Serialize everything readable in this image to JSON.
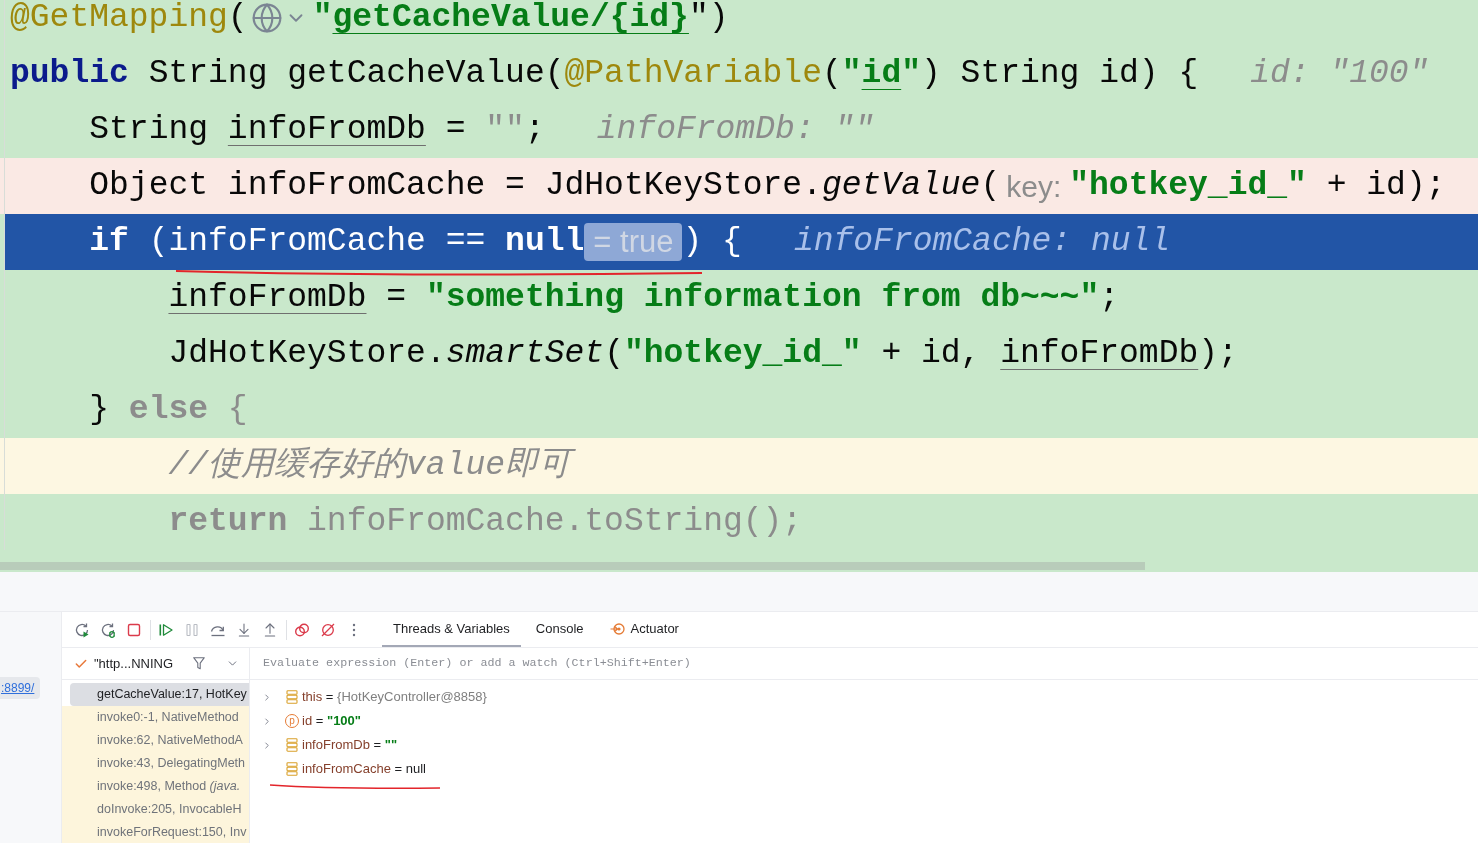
{
  "editor": {
    "lines": [
      {
        "breakpoint": false,
        "execution_point": false,
        "caret_row": false,
        "tokens": [
          {
            "kind": "annotation",
            "text": "@GetMapping"
          },
          {
            "kind": "plain",
            "text": "("
          },
          {
            "kind": "endpoint-icon"
          },
          {
            "kind": "string",
            "text": "\""
          },
          {
            "kind": "string-ref",
            "text": "getCacheValue/{id}"
          },
          {
            "kind": "plain",
            "text": "\")"
          }
        ]
      },
      {
        "breakpoint": false,
        "execution_point": false,
        "caret_row": false,
        "tokens": [
          {
            "kind": "keyword",
            "text": "public"
          },
          {
            "kind": "plain",
            "text": " String getCacheValue("
          },
          {
            "kind": "annotation",
            "text": "@PathVariable"
          },
          {
            "kind": "plain",
            "text": "("
          },
          {
            "kind": "string",
            "text": "\""
          },
          {
            "kind": "string-ref",
            "text": "id"
          },
          {
            "kind": "string",
            "text": "\""
          },
          {
            "kind": "plain",
            "text": ") String id) {"
          },
          {
            "kind": "value-hint",
            "text": "id: \"100\""
          }
        ]
      },
      {
        "breakpoint": false,
        "execution_point": false,
        "caret_row": false,
        "tokens": [
          {
            "kind": "plain",
            "text": "    String "
          },
          {
            "kind": "local",
            "text": "infoFromDb"
          },
          {
            "kind": "plain",
            "text": " = "
          },
          {
            "kind": "unused",
            "text": "\"\""
          },
          {
            "kind": "plain",
            "text": ";"
          },
          {
            "kind": "value-hint",
            "text": "infoFromDb: \"\""
          }
        ]
      },
      {
        "breakpoint": true,
        "execution_point": false,
        "caret_row": false,
        "tokens": [
          {
            "kind": "plain",
            "text": "    Object infoFromCache = JdHotKeyStore."
          },
          {
            "kind": "static-call",
            "text": "getValue"
          },
          {
            "kind": "plain",
            "text": "("
          },
          {
            "kind": "param-hint",
            "text": "key:"
          },
          {
            "kind": "string",
            "text": "\"hotkey_id_\""
          },
          {
            "kind": "plain",
            "text": " + id);"
          }
        ]
      },
      {
        "breakpoint": false,
        "execution_point": true,
        "caret_row": false,
        "tokens": [
          {
            "kind": "keyword",
            "text": "    if"
          },
          {
            "kind": "plain",
            "text": " (infoFromCache == "
          },
          {
            "kind": "keyword",
            "text": "null"
          },
          {
            "kind": "inline-value",
            "text": "= true"
          },
          {
            "kind": "plain",
            "text": ") {"
          },
          {
            "kind": "value-hint",
            "text": "infoFromCache: null"
          }
        ]
      },
      {
        "breakpoint": false,
        "execution_point": false,
        "caret_row": false,
        "tokens": [
          {
            "kind": "local",
            "text": "        infoFromDb"
          },
          {
            "kind": "plain",
            "text": " = "
          },
          {
            "kind": "string",
            "text": "\"something information from db~~~\""
          },
          {
            "kind": "plain",
            "text": ";"
          }
        ]
      },
      {
        "breakpoint": false,
        "execution_point": false,
        "caret_row": false,
        "tokens": [
          {
            "kind": "plain",
            "text": "        JdHotKeyStore."
          },
          {
            "kind": "static-call",
            "text": "smartSet"
          },
          {
            "kind": "plain",
            "text": "("
          },
          {
            "kind": "string",
            "text": "\"hotkey_id_\""
          },
          {
            "kind": "plain",
            "text": " + id, "
          },
          {
            "kind": "local",
            "text": "infoFromDb"
          },
          {
            "kind": "plain",
            "text": ");"
          }
        ]
      },
      {
        "breakpoint": false,
        "execution_point": false,
        "caret_row": false,
        "tokens": [
          {
            "kind": "plain",
            "text": "    }"
          },
          {
            "kind": "unused-keyword",
            "text": " else"
          },
          {
            "kind": "unused",
            "text": " {"
          }
        ]
      },
      {
        "breakpoint": false,
        "execution_point": false,
        "caret_row": true,
        "tokens": [
          {
            "kind": "comment",
            "text": "        //使用缓存好的value即可"
          }
        ]
      },
      {
        "breakpoint": false,
        "execution_point": false,
        "caret_row": false,
        "tokens": [
          {
            "kind": "unused-keyword",
            "text": "        return"
          },
          {
            "kind": "unused",
            "text": " infoFromCache.toString();"
          }
        ]
      }
    ]
  },
  "debugger": {
    "session_link": ":8899/",
    "toolbar": [
      {
        "kind": "rerun",
        "disabled": false
      },
      {
        "kind": "rerun-debug",
        "disabled": false
      },
      {
        "kind": "stop",
        "disabled": false
      },
      {
        "kind": "separator"
      },
      {
        "kind": "resume",
        "disabled": false
      },
      {
        "kind": "pause",
        "disabled": true
      },
      {
        "kind": "step-over",
        "disabled": false
      },
      {
        "kind": "step-into",
        "disabled": false
      },
      {
        "kind": "step-out",
        "disabled": false
      },
      {
        "kind": "separator"
      },
      {
        "kind": "view-breakpoints",
        "disabled": false
      },
      {
        "kind": "mute-breakpoints",
        "disabled": false
      },
      {
        "kind": "more",
        "disabled": false
      }
    ],
    "tabs": [
      {
        "label": "Threads & Variables",
        "selected": true,
        "kind": "builtin"
      },
      {
        "label": "Console",
        "selected": false,
        "kind": "builtin"
      },
      {
        "label": "Actuator",
        "selected": false,
        "kind": "plugin"
      }
    ],
    "thread_selector": {
      "value": "\"http...NNING"
    },
    "watch_field": {
      "placeholder": "Evaluate expression (Enter) or add a watch (Ctrl+Shift+Enter)"
    },
    "frames": [
      {
        "text": "getCacheValue:17, HotKey",
        "kind": "project",
        "selected": true
      },
      {
        "text": "invoke0:-1, NativeMethod",
        "kind": "library",
        "selected": false
      },
      {
        "text": "invoke:62, NativeMethodA",
        "kind": "library",
        "selected": false
      },
      {
        "text": "invoke:43, DelegatingMeth",
        "kind": "library",
        "selected": false
      },
      {
        "text": "invoke:498, Method *(java.*",
        "kind": "library",
        "selected": false
      },
      {
        "text": "doInvoke:205, InvocableH",
        "kind": "library",
        "selected": false
      },
      {
        "text": "invokeForRequest:150, Inv",
        "kind": "library",
        "selected": false
      }
    ],
    "variables": [
      {
        "name": "this",
        "operator": "=",
        "value": {
          "kind": "object",
          "text": "{HotKeyController@8858}"
        },
        "kind": "variable",
        "expandable": true
      },
      {
        "name": "id",
        "operator": "=",
        "value": {
          "kind": "string",
          "text": "\"100\""
        },
        "kind": "parameter",
        "badge": "p",
        "expandable": true
      },
      {
        "name": "infoFromDb",
        "operator": "=",
        "value": {
          "kind": "string",
          "text": "\"\""
        },
        "kind": "variable",
        "expandable": true
      },
      {
        "name": "infoFromCache",
        "operator": "=",
        "value": {
          "kind": "null",
          "text": "null"
        },
        "kind": "variable",
        "expandable": false
      }
    ]
  }
}
